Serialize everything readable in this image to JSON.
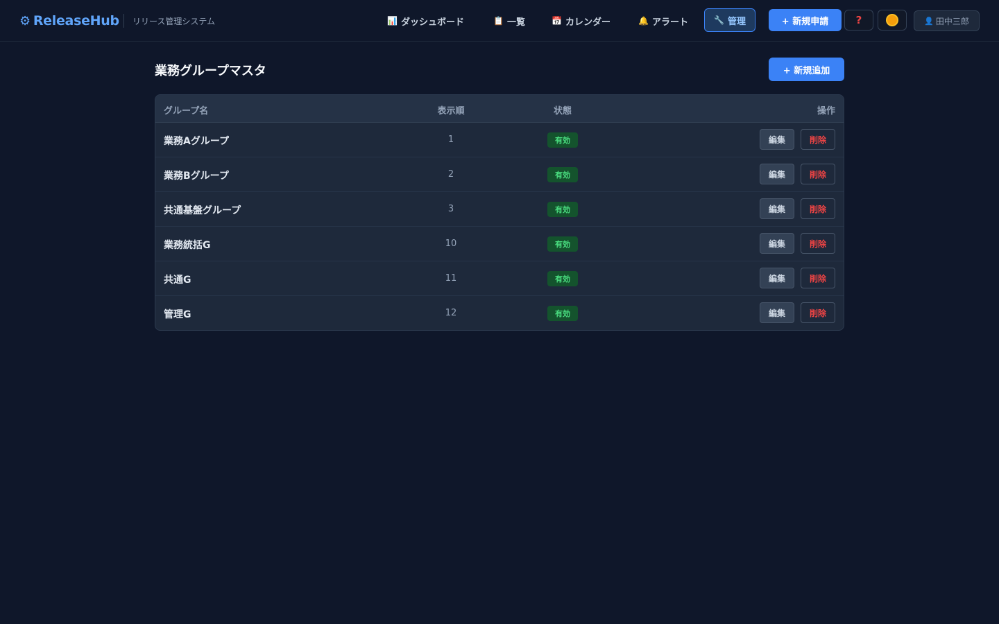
{
  "header": {
    "brand": "ReleaseHub",
    "brand_icon": "gear-icon",
    "subtitle": "リリース管理システム",
    "nav": [
      {
        "label": "ダッシュボード",
        "icon": "chart-icon"
      },
      {
        "label": "一覧",
        "icon": "list-icon"
      },
      {
        "label": "カレンダー",
        "icon": "calendar-icon"
      },
      {
        "label": "アラート",
        "icon": "bell-icon"
      },
      {
        "label": "管理",
        "icon": "wrench-icon"
      }
    ],
    "new_request": "+ 新規申請",
    "help_label": "?",
    "user_name": "田中三郎"
  },
  "main": {
    "title": "業務グループマスタ",
    "add_button": "+ 新規追加",
    "table": {
      "headers": {
        "name": "グループ名",
        "order": "表示順",
        "status": "状態",
        "actions": "操作"
      },
      "rows": [
        {
          "name": "業務Aグループ",
          "order": "1",
          "status": "有効"
        },
        {
          "name": "業務Bグループ",
          "order": "2",
          "status": "有効"
        },
        {
          "name": "共通基盤グループ",
          "order": "3",
          "status": "有効"
        },
        {
          "name": "業務統括G",
          "order": "10",
          "status": "有効"
        },
        {
          "name": "共通G",
          "order": "11",
          "status": "有効"
        },
        {
          "name": "管理G",
          "order": "12",
          "status": "有効"
        }
      ],
      "edit_label": "編集",
      "delete_label": "削除"
    }
  },
  "colors": {
    "background": "#0f172a",
    "accent": "#3b82f6",
    "brand": "#60a5fa",
    "status_active": "#4ade80",
    "danger": "#ef4444"
  }
}
